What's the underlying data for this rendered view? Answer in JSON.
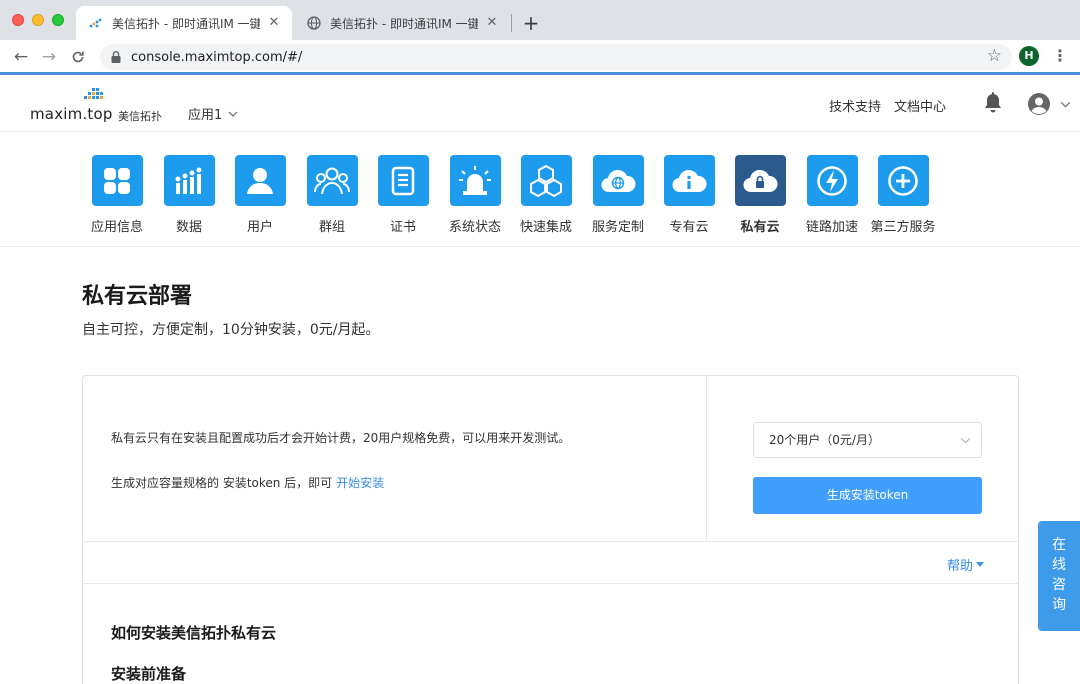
{
  "browser": {
    "tabs": [
      {
        "title": "美信拓扑 - 即时通讯IM 一键启用",
        "active": true
      },
      {
        "title": "美信拓扑 - 即时通讯IM 一键启用",
        "active": false
      }
    ],
    "url": "console.maximtop.com/#/",
    "profile_initial": "H"
  },
  "header": {
    "logo_text": "maxim.top",
    "logo_cn": "美信拓扑",
    "app_selector": "应用1",
    "links": [
      "技术支持",
      "文档中心"
    ]
  },
  "nav": {
    "items": [
      {
        "label": "应用信息",
        "icon": "grid-icon"
      },
      {
        "label": "数据",
        "icon": "bar-chart-icon"
      },
      {
        "label": "用户",
        "icon": "user-icon"
      },
      {
        "label": "群组",
        "icon": "group-icon"
      },
      {
        "label": "证书",
        "icon": "certificate-icon"
      },
      {
        "label": "系统状态",
        "icon": "alarm-light-icon"
      },
      {
        "label": "快速集成",
        "icon": "cubes-icon"
      },
      {
        "label": "服务定制",
        "icon": "cloud-globe-icon"
      },
      {
        "label": "专有云",
        "icon": "cloud-info-icon"
      },
      {
        "label": "私有云",
        "icon": "cloud-lock-icon",
        "active": true
      },
      {
        "label": "链路加速",
        "icon": "lightning-icon"
      },
      {
        "label": "第三方服务",
        "icon": "plus-icon"
      }
    ]
  },
  "main": {
    "title": "私有云部署",
    "subtitle": "自主可控，方便定制，10分钟安装，0元/月起。",
    "card": {
      "text1": "私有云只有在安装且配置成功后才会开始计费，20用户规格免费，可以用来开发测试。",
      "text2": "生成对应容量规格的 安装token 后，即可",
      "link": "开始安装",
      "select_value": "20个用户（0元/月）",
      "button": "生成安装token",
      "help": "帮助",
      "heading_install": "如何安装美信拓扑私有云",
      "heading_prep": "安装前准备"
    }
  },
  "consult": [
    "在",
    "线",
    "咨",
    "询"
  ],
  "colors": {
    "accent": "#1d9bec",
    "active_tile": "#2b5a8c",
    "primary_button": "#409eff",
    "link": "#3a8ee6"
  }
}
